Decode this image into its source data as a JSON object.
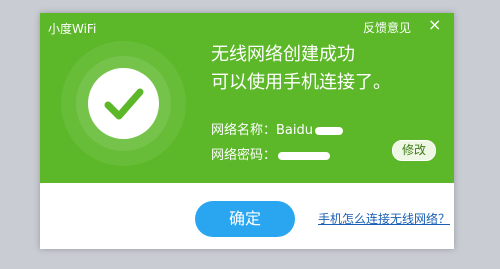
{
  "window": {
    "app_title": "小度WiFi",
    "feedback_label": "反馈意见",
    "close_symbol": "×"
  },
  "message": {
    "line1": "无线网络创建成功",
    "line2": "可以使用手机连接了。"
  },
  "network": {
    "name_label": "网络名称：",
    "name_value": "Baidu",
    "password_label": "网络密码：",
    "edit_label": "修改"
  },
  "actions": {
    "ok_label": "确定",
    "help_link": "手机怎么连接无线网络？"
  },
  "icons": {
    "success": "check-icon",
    "close": "close-icon"
  },
  "colors": {
    "header": "#5cb829",
    "primary_button": "#2aa5ef",
    "link": "#1a5fb4"
  }
}
